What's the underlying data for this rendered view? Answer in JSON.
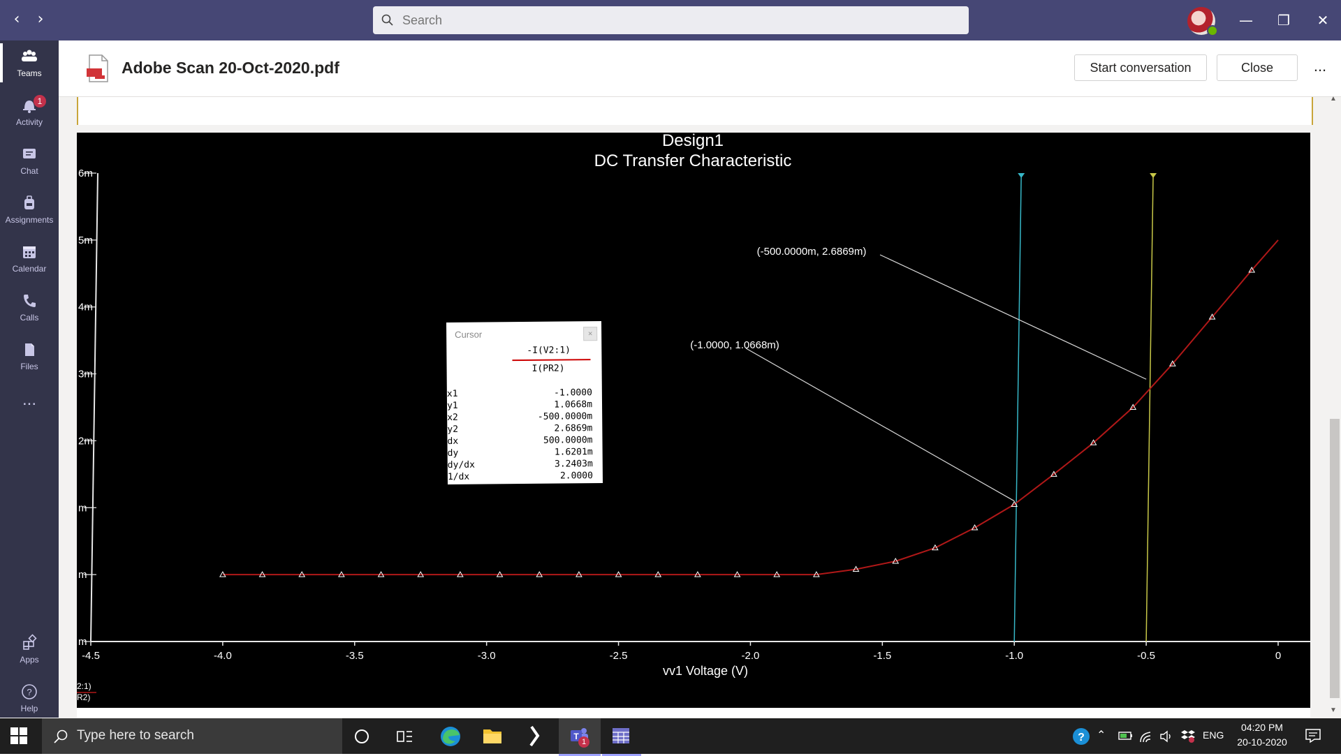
{
  "topbar": {
    "search_placeholder": "Search",
    "back_icon": "chevron-left-icon",
    "forward_icon": "chevron-right-icon"
  },
  "rail": {
    "items": [
      {
        "label": "Teams",
        "icon": "teams-icon"
      },
      {
        "label": "Activity",
        "icon": "bell-icon",
        "badge": "1"
      },
      {
        "label": "Chat",
        "icon": "chat-icon"
      },
      {
        "label": "Assignments",
        "icon": "backpack-icon"
      },
      {
        "label": "Calendar",
        "icon": "calendar-icon"
      },
      {
        "label": "Calls",
        "icon": "phone-icon"
      },
      {
        "label": "Files",
        "icon": "files-icon"
      },
      {
        "label": "Apps",
        "icon": "apps-icon"
      },
      {
        "label": "Help",
        "icon": "help-icon"
      }
    ],
    "more": "..."
  },
  "header": {
    "file_title": "Adobe Scan 20-Oct-2020.pdf",
    "start_conversation": "Start conversation",
    "close": "Close",
    "more": "..."
  },
  "chart_data": {
    "type": "line",
    "title": "Design1",
    "subtitle": "DC Transfer Characteristic",
    "xlabel": "vv1 Voltage (V)",
    "xlim": [
      -4.5,
      0
    ],
    "ylim": [
      0,
      7
    ],
    "x_ticks": [
      "-4.5",
      "-4.0",
      "-3.5",
      "-3.0",
      "-2.5",
      "-2.0",
      "-1.5",
      "-1.0",
      "-0.5",
      "0"
    ],
    "y_ticks": [
      "m",
      "m",
      "m",
      "2m",
      "3m",
      "4m",
      "5m",
      "6m"
    ],
    "legend": [
      "2:1)",
      "R2)"
    ],
    "series": [
      {
        "color": "#b01818",
        "x": [
          -4.0,
          -3.85,
          -3.7,
          -3.55,
          -3.4,
          -3.25,
          -3.1,
          -2.95,
          -2.8,
          -2.65,
          -2.5,
          -2.35,
          -2.2,
          -2.05,
          -1.9,
          -1.75,
          -1.6,
          -1.45,
          -1.3,
          -1.15,
          -1.0,
          -0.85,
          -0.7,
          -0.55,
          -0.4,
          -0.25,
          -0.1,
          0.0
        ],
        "y": [
          1.0,
          1.0,
          1.0,
          1.0,
          1.0,
          1.0,
          1.0,
          1.0,
          1.0,
          1.0,
          1.0,
          1.0,
          1.0,
          1.0,
          1.0,
          1.0,
          1.08,
          1.2,
          1.4,
          1.7,
          2.05,
          2.5,
          2.97,
          3.5,
          4.15,
          4.85,
          5.55,
          6.0
        ]
      }
    ],
    "markers_x": [
      -4.0,
      -3.85,
      -3.7,
      -3.55,
      -3.4,
      -3.25,
      -3.1,
      -2.95,
      -2.8,
      -2.65,
      -2.5,
      -2.35,
      -2.2,
      -2.05,
      -1.9,
      -1.75,
      -1.6,
      -1.45,
      -1.3,
      -1.15,
      -1.0,
      -0.85,
      -0.7,
      -0.55,
      -0.4,
      -0.25,
      -0.1
    ],
    "cursors": [
      {
        "x": -1.0,
        "color": "#37b8c8"
      },
      {
        "x": -0.5,
        "color": "#c8c848"
      }
    ],
    "annotations": [
      {
        "text": "(-500.0000m, 2.6869m)",
        "x": -0.5,
        "y": 3.92
      },
      {
        "text": "(-1.0000, 1.0668m)",
        "x": -1.0,
        "y": 2.1
      }
    ]
  },
  "cursor_panel": {
    "title": "Cursor",
    "trace_top": "-I(V2:1)",
    "trace_bottom": "I(PR2)",
    "rows": [
      {
        "k": "x1",
        "v": "-1.0000"
      },
      {
        "k": "y1",
        "v": "1.0668m"
      },
      {
        "k": "x2",
        "v": "-500.0000m"
      },
      {
        "k": "y2",
        "v": "2.6869m"
      },
      {
        "k": "dx",
        "v": "500.0000m"
      },
      {
        "k": "dy",
        "v": "1.6201m"
      },
      {
        "k": "dy/dx",
        "v": "3.2403m"
      },
      {
        "k": "1/dx",
        "v": "2.0000"
      }
    ]
  },
  "taskbar": {
    "search_placeholder": "Type here to search",
    "lang": "ENG",
    "time": "04:20 PM",
    "date": "20-10-2020",
    "teams_badge": "1"
  }
}
